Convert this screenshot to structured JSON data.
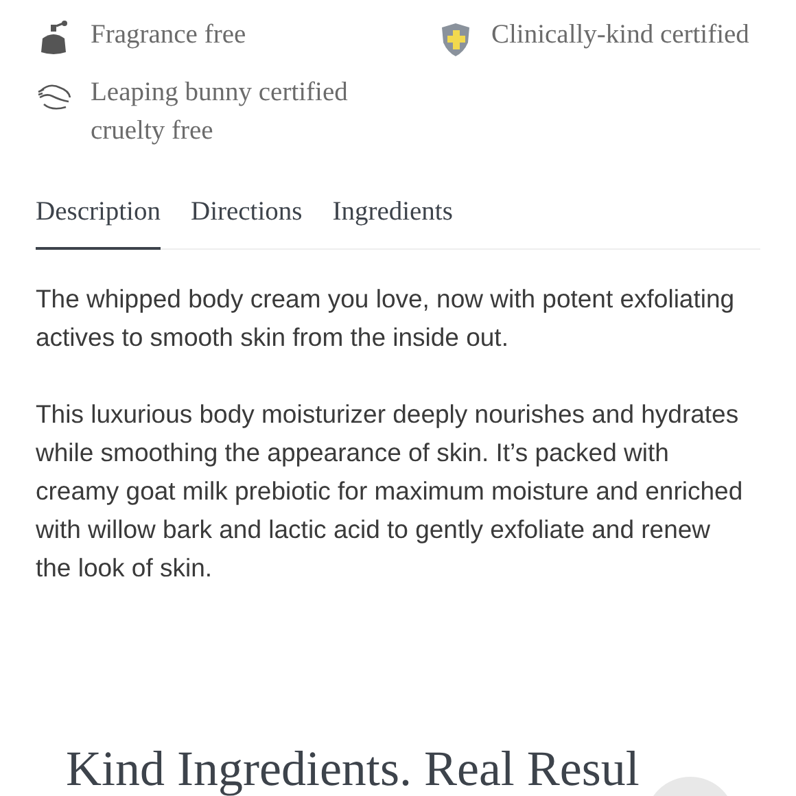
{
  "features": [
    {
      "kind": "fragrance",
      "label": "Fragrance free"
    },
    {
      "kind": "clinical",
      "label": "Clinically-kind certified"
    },
    {
      "kind": "bunny",
      "label": "Leaping bunny certified cruelty free"
    }
  ],
  "tabs": [
    {
      "label": "Description",
      "selected": true
    },
    {
      "label": "Directions",
      "selected": false
    },
    {
      "label": "Ingredients",
      "selected": false
    }
  ],
  "paragraphs": [
    "The whipped body cream you love, now with potent exfoliating actives to smooth skin from the inside out.",
    "This luxurious body moisturizer deeply nourishes and hydrates while smoothing the appearance of skin. It’s packed with creamy goat milk prebiotic for maximum moisture and enriched with willow bark and lactic acid to gently exfoliate and renew the look of skin."
  ],
  "section_heading": "Kind Ingredients. Real Resul"
}
